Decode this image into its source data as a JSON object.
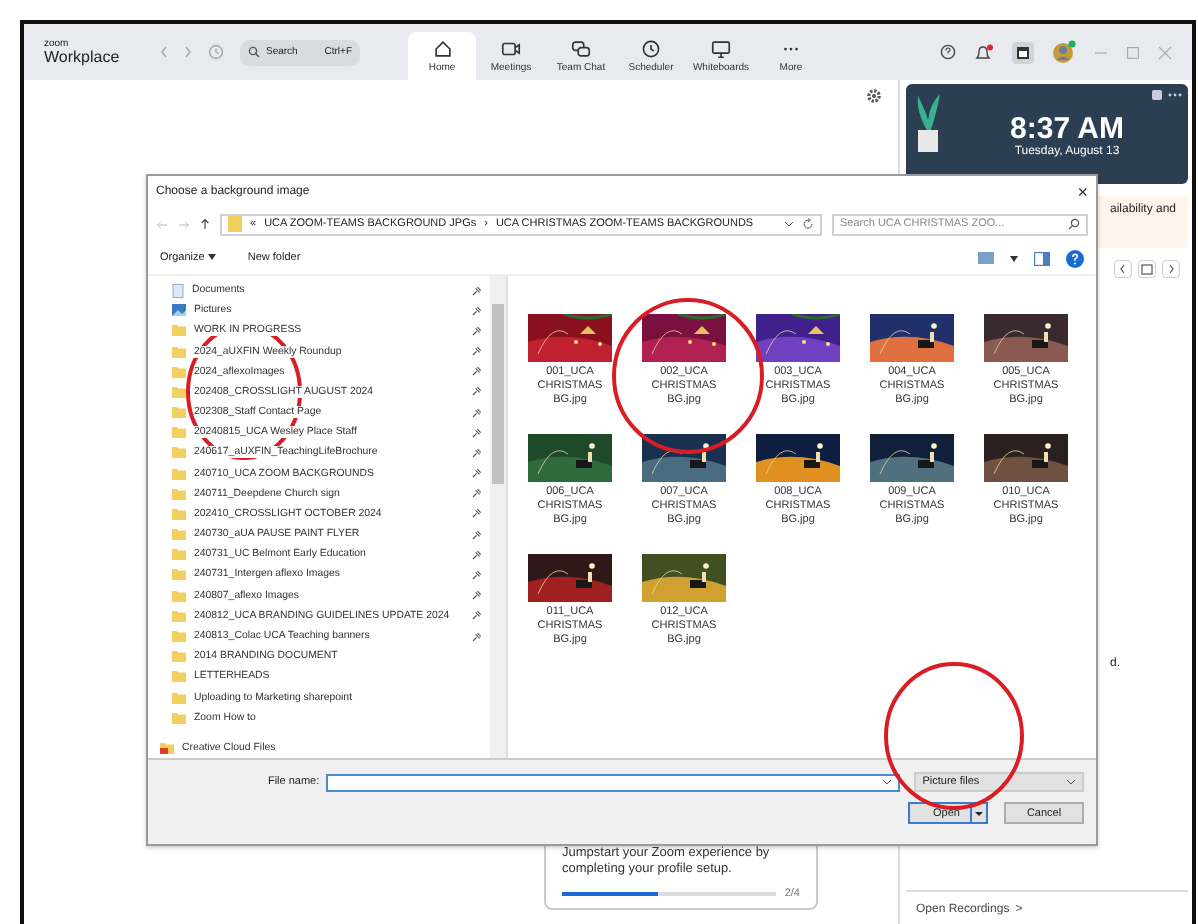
{
  "app": {
    "logo_top": "zoom",
    "logo_bottom": "Workplace",
    "search": "Search",
    "search_shortcut": "Ctrl+F"
  },
  "nav_tabs": [
    {
      "label": "Home",
      "kind": "home",
      "selected": true
    },
    {
      "label": "Meetings",
      "kind": "camera",
      "selected": false
    },
    {
      "label": "Team Chat",
      "kind": "chat",
      "selected": false
    },
    {
      "label": "Scheduler",
      "kind": "clock",
      "selected": false
    },
    {
      "label": "Whiteboards",
      "kind": "board",
      "selected": false
    },
    {
      "label": "More",
      "kind": "dots",
      "selected": false
    }
  ],
  "clock": {
    "time": "8:37 AM",
    "date": "Tuesday, August 13"
  },
  "side_texts": [
    "ailability and",
    "d."
  ],
  "profile_card": {
    "line_1": "Jumpstart your Zoom experience by",
    "line_2": "completing your profile setup.",
    "level": 0.45,
    "progress": "2/4"
  },
  "recordings": {
    "label": "Open Recordings",
    "chevron": ">"
  },
  "dialog": {
    "title": "Choose a background image",
    "close": "×",
    "path_prefix": "«",
    "path_separator": "›",
    "path": [
      "UCA ZOOM-TEAMS BACKGROUND JPGs",
      "UCA CHRISTMAS ZOOM-TEAMS BACKGROUNDS"
    ],
    "search_placeholder": "Search UCA CHRISTMAS ZOO...",
    "organize": "Organize",
    "new_folder": "New folder",
    "folders": [
      {
        "name": "Documents",
        "kind": "library",
        "pinned": true
      },
      {
        "name": "Pictures",
        "kind": "pictures",
        "pinned": true
      },
      {
        "name": "WORK IN PROGRESS",
        "kind": "folder",
        "pinned": true
      },
      {
        "name": "2024_aUXFIN Weekly Roundup",
        "kind": "folder",
        "pinned": true
      },
      {
        "name": "2024_aflexoImages",
        "kind": "folder",
        "pinned": true
      },
      {
        "name": "202408_CROSSLIGHT AUGUST 2024",
        "kind": "folder",
        "pinned": true
      },
      {
        "name": "202308_Staff Contact Page",
        "kind": "folder",
        "pinned": true
      },
      {
        "name": "20240815_UCA Wesley Place Staff",
        "kind": "folder",
        "pinned": true
      },
      {
        "name": "240617_aUXFIN_TeachingLifeBrochure",
        "kind": "folder",
        "pinned": true
      },
      {
        "name": "240710_UCA ZOOM BACKGROUNDS",
        "kind": "folder",
        "pinned": true
      },
      {
        "name": "240711_Deepdene Church sign",
        "kind": "folder",
        "pinned": true
      },
      {
        "name": "202410_CROSSLIGHT OCTOBER 2024",
        "kind": "folder",
        "pinned": true
      },
      {
        "name": "240730_aUA PAUSE PAINT FLYER",
        "kind": "folder",
        "pinned": true
      },
      {
        "name": "240731_UC Belmont Early Education",
        "kind": "folder",
        "pinned": true
      },
      {
        "name": "240731_Intergen aflexo Images",
        "kind": "folder",
        "pinned": true
      },
      {
        "name": "240807_aflexo Images",
        "kind": "folder",
        "pinned": true
      },
      {
        "name": "240812_UCA BRANDING GUIDELINES UPDATE 2024",
        "kind": "folder",
        "pinned": true
      },
      {
        "name": "240813_Colac UCA Teaching banners",
        "kind": "folder",
        "pinned": true
      },
      {
        "name": "2014 BRANDING DOCUMENT",
        "kind": "folder",
        "pinned": false
      },
      {
        "name": "LETTERHEADS",
        "kind": "folder",
        "pinned": false
      },
      {
        "name": "Uploading to Marketing sharepoint",
        "kind": "folder",
        "pinned": false
      },
      {
        "name": "Zoom How to",
        "kind": "folder",
        "pinned": false
      },
      {
        "name": "Creative Cloud Files",
        "kind": "cloud",
        "pinned": false
      }
    ],
    "files": [
      {
        "name": "001_UCA CHRISTMAS BG.jpg",
        "kind": "picture"
      },
      {
        "name": "002_UCA CHRISTMAS BG.jpg",
        "kind": "picture"
      },
      {
        "name": "003_UCA CHRISTMAS BG.jpg",
        "kind": "picture"
      },
      {
        "name": "004_UCA CHRISTMAS BG.jpg",
        "kind": "picture"
      },
      {
        "name": "005_UCA CHRISTMAS BG.jpg",
        "kind": "picture"
      },
      {
        "name": "006_UCA CHRISTMAS BG.jpg",
        "kind": "picture"
      },
      {
        "name": "007_UCA CHRISTMAS BG.jpg",
        "kind": "picture"
      },
      {
        "name": "008_UCA CHRISTMAS BG.jpg",
        "kind": "picture"
      },
      {
        "name": "009_UCA CHRISTMAS BG.jpg",
        "kind": "picture"
      },
      {
        "name": "010_UCA CHRISTMAS BG.jpg",
        "kind": "picture"
      },
      {
        "name": "011_UCA CHRISTMAS BG.jpg",
        "kind": "picture"
      },
      {
        "name": "012_UCA CHRISTMAS BG.jpg",
        "kind": "picture"
      }
    ],
    "file_name_label": "File name:",
    "file_type": "Picture files",
    "buttons": [
      {
        "label": "Open",
        "kind": "primary"
      },
      {
        "label": "Cancel",
        "kind": "normal"
      }
    ]
  }
}
